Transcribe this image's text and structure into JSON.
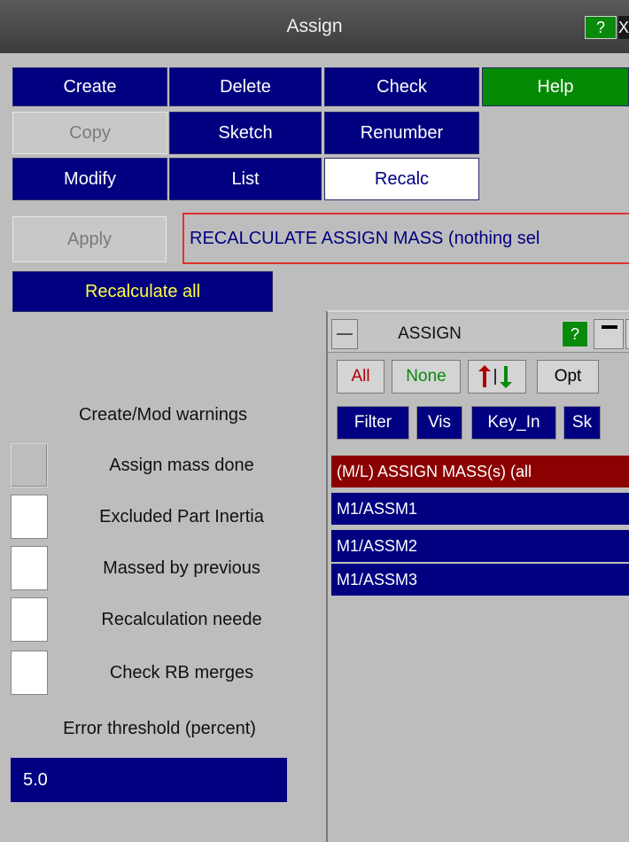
{
  "window": {
    "title": "Assign",
    "help_label": "?",
    "close_label": "X"
  },
  "toolbar": {
    "create": "Create",
    "delete": "Delete",
    "check": "Check",
    "help": "Help",
    "copy": "Copy",
    "sketch": "Sketch",
    "renumber": "Renumber",
    "modify": "Modify",
    "list": "List",
    "recalc": "Recalc"
  },
  "action": {
    "apply": "Apply",
    "message": "RECALCULATE ASSIGN MASS (nothing sel",
    "recalculate_all": "Recalculate all"
  },
  "warnings": {
    "heading": "Create/Mod warnings",
    "items": [
      {
        "label": "Assign mass done"
      },
      {
        "label": "Excluded Part Inertia"
      },
      {
        "label": "Massed by previous"
      },
      {
        "label": "Recalculation neede"
      },
      {
        "label": "Check RB merges"
      }
    ],
    "threshold_label": "Error threshold (percent)",
    "threshold_value": "5.0"
  },
  "subpanel": {
    "title": "ASSIGN",
    "help_label": "?",
    "buttons": {
      "all": "All",
      "none": "None",
      "opt": "Opt",
      "filter": "Filter",
      "vis": "Vis",
      "key_in": "Key_In",
      "sk": "Sk"
    },
    "list_header": "(M/L) ASSIGN MASS(s) (all",
    "list_items": [
      "M1/ASSM1",
      "M1/ASSM2",
      "M1/ASSM3"
    ]
  },
  "colors": {
    "accent": "#000080",
    "help_green": "#058a05",
    "header_red": "#8b0000",
    "warning_red": "#e03030",
    "background": "#bdbdbd"
  }
}
